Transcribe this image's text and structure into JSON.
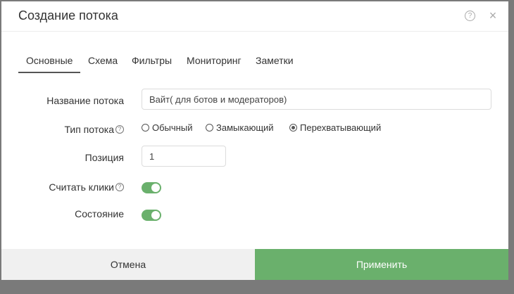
{
  "header": {
    "title": "Создание потока",
    "help_icon": "question-circle-icon",
    "close_icon": "close-icon",
    "help_glyph": "?",
    "close_glyph": "×"
  },
  "tabs": [
    {
      "label": "Основные",
      "active": true
    },
    {
      "label": "Схема",
      "active": false
    },
    {
      "label": "Фильтры",
      "active": false
    },
    {
      "label": "Мониторинг",
      "active": false
    },
    {
      "label": "Заметки",
      "active": false
    }
  ],
  "form": {
    "name": {
      "label": "Название потока",
      "value": "Вайт( для ботов и модераторов)"
    },
    "type": {
      "label": "Тип потока",
      "help_glyph": "?",
      "options": [
        {
          "label": "Обычный",
          "checked": false
        },
        {
          "label": "Замыкающий",
          "checked": false
        },
        {
          "label": "Перехватывающий",
          "checked": true
        }
      ]
    },
    "position": {
      "label": "Позиция",
      "value": "1"
    },
    "count_clicks": {
      "label": "Считать клики",
      "help_glyph": "?",
      "on": true
    },
    "state": {
      "label": "Состояние",
      "on": true
    }
  },
  "footer": {
    "cancel_label": "Отмена",
    "apply_label": "Применить"
  },
  "colors": {
    "toggle_on": "#6ab06c",
    "apply_bg": "#6ab06c",
    "cancel_bg": "#f0f0f0",
    "overlay": "#7a7a7a"
  }
}
